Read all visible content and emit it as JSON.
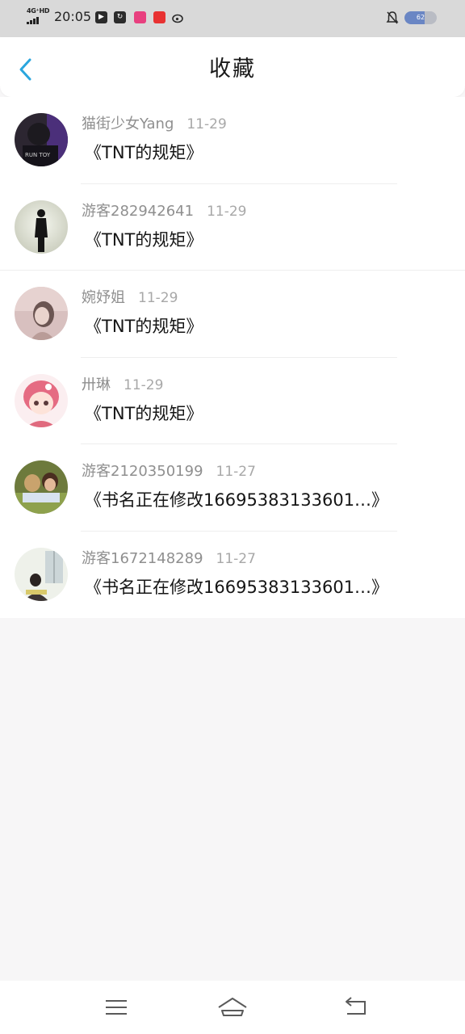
{
  "status_bar": {
    "network": "4G⁺HD",
    "time": "20:05",
    "battery": "62",
    "battery_level": 0.62,
    "apps": [
      {
        "icon": "video-app-icon",
        "color": "#2b2b2b",
        "glyph": "▶"
      },
      {
        "icon": "refresh-app-icon",
        "color": "#2b2b2b",
        "glyph": "↻"
      },
      {
        "icon": "shopping-app-icon",
        "color": "#e8407f",
        "glyph": ""
      },
      {
        "icon": "red-app-icon",
        "color": "#e83232",
        "glyph": ""
      },
      {
        "icon": "weibo-icon",
        "color": "#2b2b2b",
        "glyph": ""
      }
    ]
  },
  "header": {
    "title": "收藏",
    "back_icon": "chevron-left-icon",
    "accent": "#2aa6de"
  },
  "favorites": [
    {
      "user": "猫街少女Yang",
      "date": "11-29",
      "title": "《TNT的规矩》",
      "avatar": "dark-portrait"
    },
    {
      "user": "游客282942641",
      "date": "11-29",
      "title": "《TNT的规矩》",
      "avatar": "silhouette"
    },
    {
      "user": "婉妤姐",
      "date": "11-29",
      "title": "《TNT的规矩》",
      "avatar": "pink-portrait"
    },
    {
      "user": "卅琳",
      "date": "11-29",
      "title": "《TNT的规矩》",
      "avatar": "anime-girl"
    },
    {
      "user": "游客2120350199",
      "date": "11-27",
      "title": "《书名正在修改1669538313360​1…》",
      "avatar": "couple-photo"
    },
    {
      "user": "游客1672148289",
      "date": "11-27",
      "title": "《书名正在修改1669538313360​1…》",
      "avatar": "reading-girl"
    }
  ],
  "nav_bar": {
    "menu_icon": "menu-icon",
    "home_icon": "home-icon",
    "back_icon": "back-icon"
  }
}
